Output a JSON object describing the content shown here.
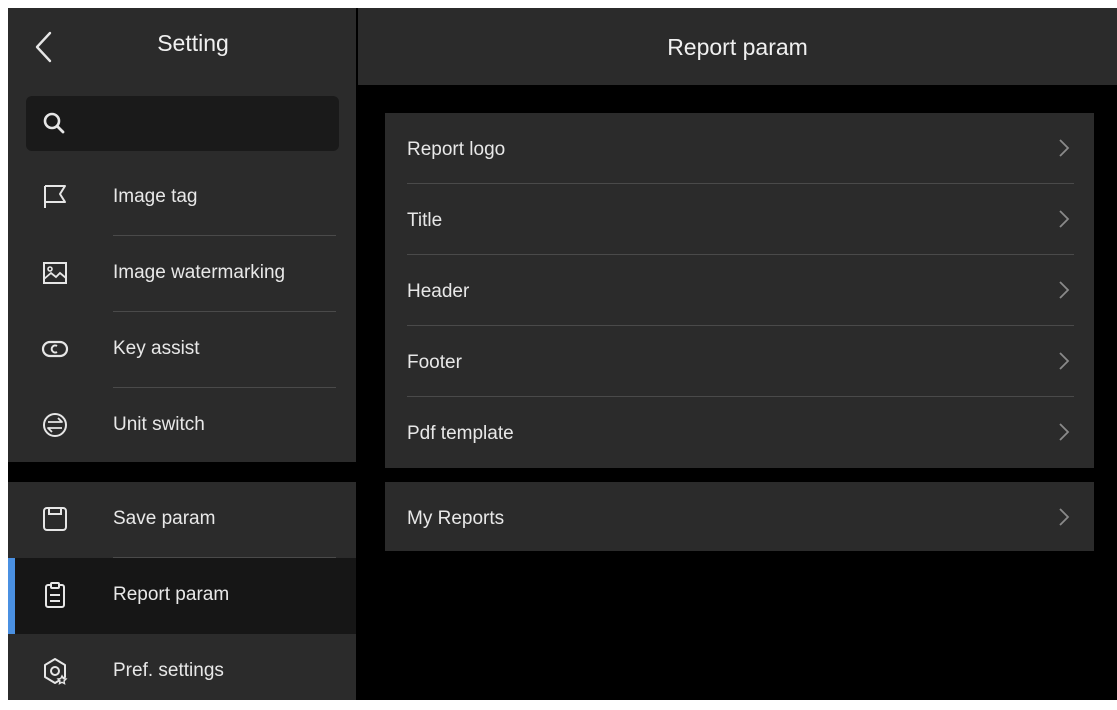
{
  "sidebar": {
    "title": "Setting",
    "search": {
      "placeholder": ""
    },
    "group1": [
      {
        "label": "Image tag",
        "icon": "flag-icon"
      },
      {
        "label": "Image watermarking",
        "icon": "image-icon"
      },
      {
        "label": "Key assist",
        "icon": "key-icon"
      },
      {
        "label": "Unit switch",
        "icon": "swap-icon"
      }
    ],
    "group2": [
      {
        "label": "Save param",
        "icon": "save-icon"
      },
      {
        "label": "Report param",
        "icon": "clipboard-icon",
        "active": true
      },
      {
        "label": "Pref. settings",
        "icon": "gear-star-icon"
      }
    ]
  },
  "main": {
    "title": "Report param",
    "card1": [
      {
        "label": "Report logo"
      },
      {
        "label": "Title"
      },
      {
        "label": "Header"
      },
      {
        "label": "Footer"
      },
      {
        "label": "Pdf template"
      }
    ],
    "card2": [
      {
        "label": "My Reports"
      }
    ]
  },
  "colors": {
    "accent": "#4a90e2",
    "panel": "#2b2b2b",
    "background": "#000000"
  }
}
